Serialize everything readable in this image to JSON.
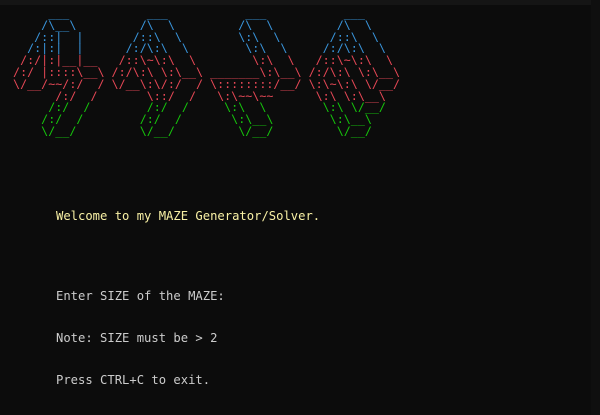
{
  "colors": {
    "background": "#0c0c0c",
    "cyan": "#3a96dd",
    "red": "#e74856",
    "green": "#16c60c",
    "yellow": "#f9f1a5",
    "white": "#cccccc"
  },
  "banner": {
    "lines": [
      {
        "text": "      ___           ___           ___           ___     ",
        "color": "#3a96dd"
      },
      {
        "text": "     /\\__\\         /\\  \\         /\\  \\         /\\  \\    ",
        "color": "#3a96dd"
      },
      {
        "text": "    /::|  |       /::\\  \\        \\:\\  \\       /::\\  \\   ",
        "color": "#3a96dd"
      },
      {
        "text": "   /:|:|  |      /:/\\:\\  \\        \\:\\  \\     /:/\\:\\  \\  ",
        "color": "#3a96dd"
      },
      {
        "text": "  /:/|:|__|__   /::\\~\\:\\  \\        \\:\\  \\   /::\\~\\:\\  \\ ",
        "color": "#e74856"
      },
      {
        "text": " /:/ |::::\\__\\ /:/\\:\\ \\:\\__\\ _______\\:\\__\\ /:/\\:\\ \\:\\__\\",
        "color": "#e74856"
      },
      {
        "text": " \\/__/~~/:/  / \\/__\\:\\/:/  / \\::::::::/__/ \\:\\~\\:\\ \\/__/",
        "color": "#e74856"
      },
      {
        "text": "       /:/  /       \\::/  /   \\:\\~~\\~~      \\:\\ \\:\\__\\  ",
        "color": "#e74856"
      },
      {
        "text": "      /:/  /        /:/  /     \\:\\  \\        \\:\\ \\/__/  ",
        "color": "#16c60c"
      },
      {
        "text": "     /:/  /        /:/  /       \\:\\__\\        \\:\\__\\    ",
        "color": "#16c60c"
      },
      {
        "text": "     \\/__/         \\/__/         \\/__/         \\/__/    ",
        "color": "#16c60c"
      }
    ]
  },
  "messages": {
    "welcome": "Welcome to my MAZE Generator/Solver.",
    "prompt": "Enter SIZE of the MAZE:",
    "note": "Note: SIZE must be > 2",
    "exit_hint": "Press CTRL+C to exit."
  }
}
